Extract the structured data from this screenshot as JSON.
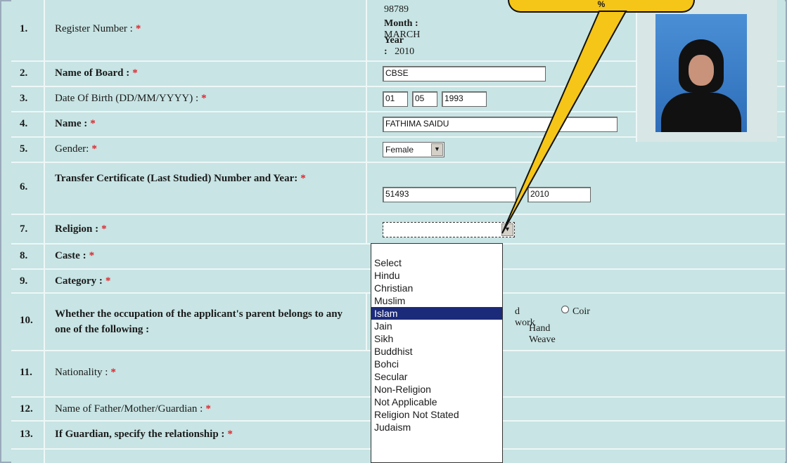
{
  "rows": [
    {
      "num": "1.",
      "label": "Register Number :",
      "reg": "98789",
      "month_label": "Month :",
      "month": "MARCH",
      "year_label": "Year :",
      "year": "2010"
    },
    {
      "num": "2.",
      "label": "Name of Board :",
      "value": "CBSE"
    },
    {
      "num": "3.",
      "label": "Date Of Birth (DD/MM/YYYY) :",
      "dd": "01",
      "mm": "05",
      "yyyy": "1993"
    },
    {
      "num": "4.",
      "label": "Name :",
      "value": "FATHIMA SAIDU"
    },
    {
      "num": "5.",
      "label": "Gender:",
      "value": "Female"
    },
    {
      "num": "6.",
      "label": "Transfer Certificate (Last Studied) Number and Year:",
      "tc": "51493",
      "year": "2010"
    },
    {
      "num": "7.",
      "label": "Religion :",
      "value": ""
    },
    {
      "num": "8.",
      "label": "Caste :"
    },
    {
      "num": "9.",
      "label": "Category :"
    },
    {
      "num": "10.",
      "label": "Whether the occupation of the applicant's parent belongs to any one of the following :",
      "opt1": "d work",
      "opt2": "Coir",
      "opt3": "Hand Weave"
    },
    {
      "num": "11.",
      "label": "Nationality :"
    },
    {
      "num": "12.",
      "label": "Name of Father/Mother/Guardian :"
    },
    {
      "num": "13.",
      "label": "If Guardian, specify the relationship :"
    }
  ],
  "required_mark": "*",
  "religion_options": [
    "Select",
    "Hindu",
    "Christian",
    "Muslim",
    "Islam",
    "Jain",
    "Sikh",
    "Buddhist",
    "Bohci",
    "Secular",
    "Non-Religion",
    "Not Applicable",
    "Religion Not Stated",
    "Judaism"
  ],
  "highlighted_option": "Islam",
  "callout_text": "%"
}
